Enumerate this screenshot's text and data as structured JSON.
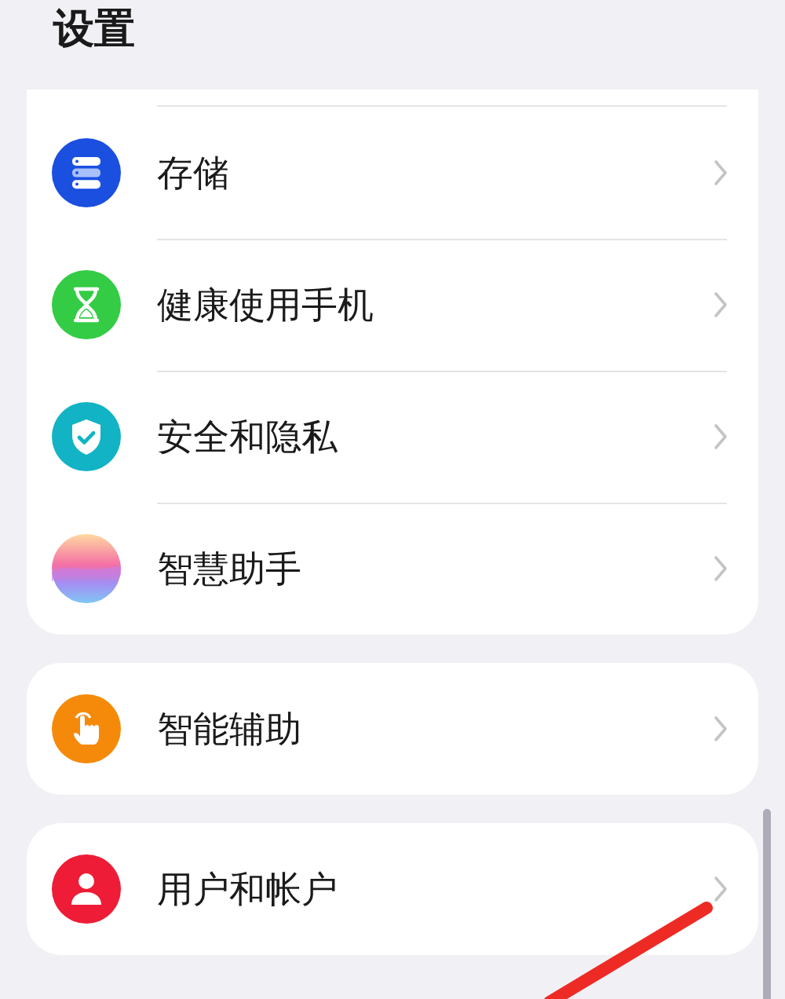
{
  "title": "设置",
  "sections": [
    {
      "items": [
        {
          "label": "存储",
          "color": "#1a4fe0"
        },
        {
          "label": "健康使用手机",
          "color": "#33cc44"
        },
        {
          "label": "安全和隐私",
          "color": "#12b3c4"
        },
        {
          "label": "智慧助手"
        }
      ]
    },
    {
      "items": [
        {
          "label": "智能辅助",
          "color": "#f58a0a"
        }
      ]
    },
    {
      "items": [
        {
          "label": "用户和帐户",
          "color": "#ee1c36"
        }
      ]
    }
  ]
}
